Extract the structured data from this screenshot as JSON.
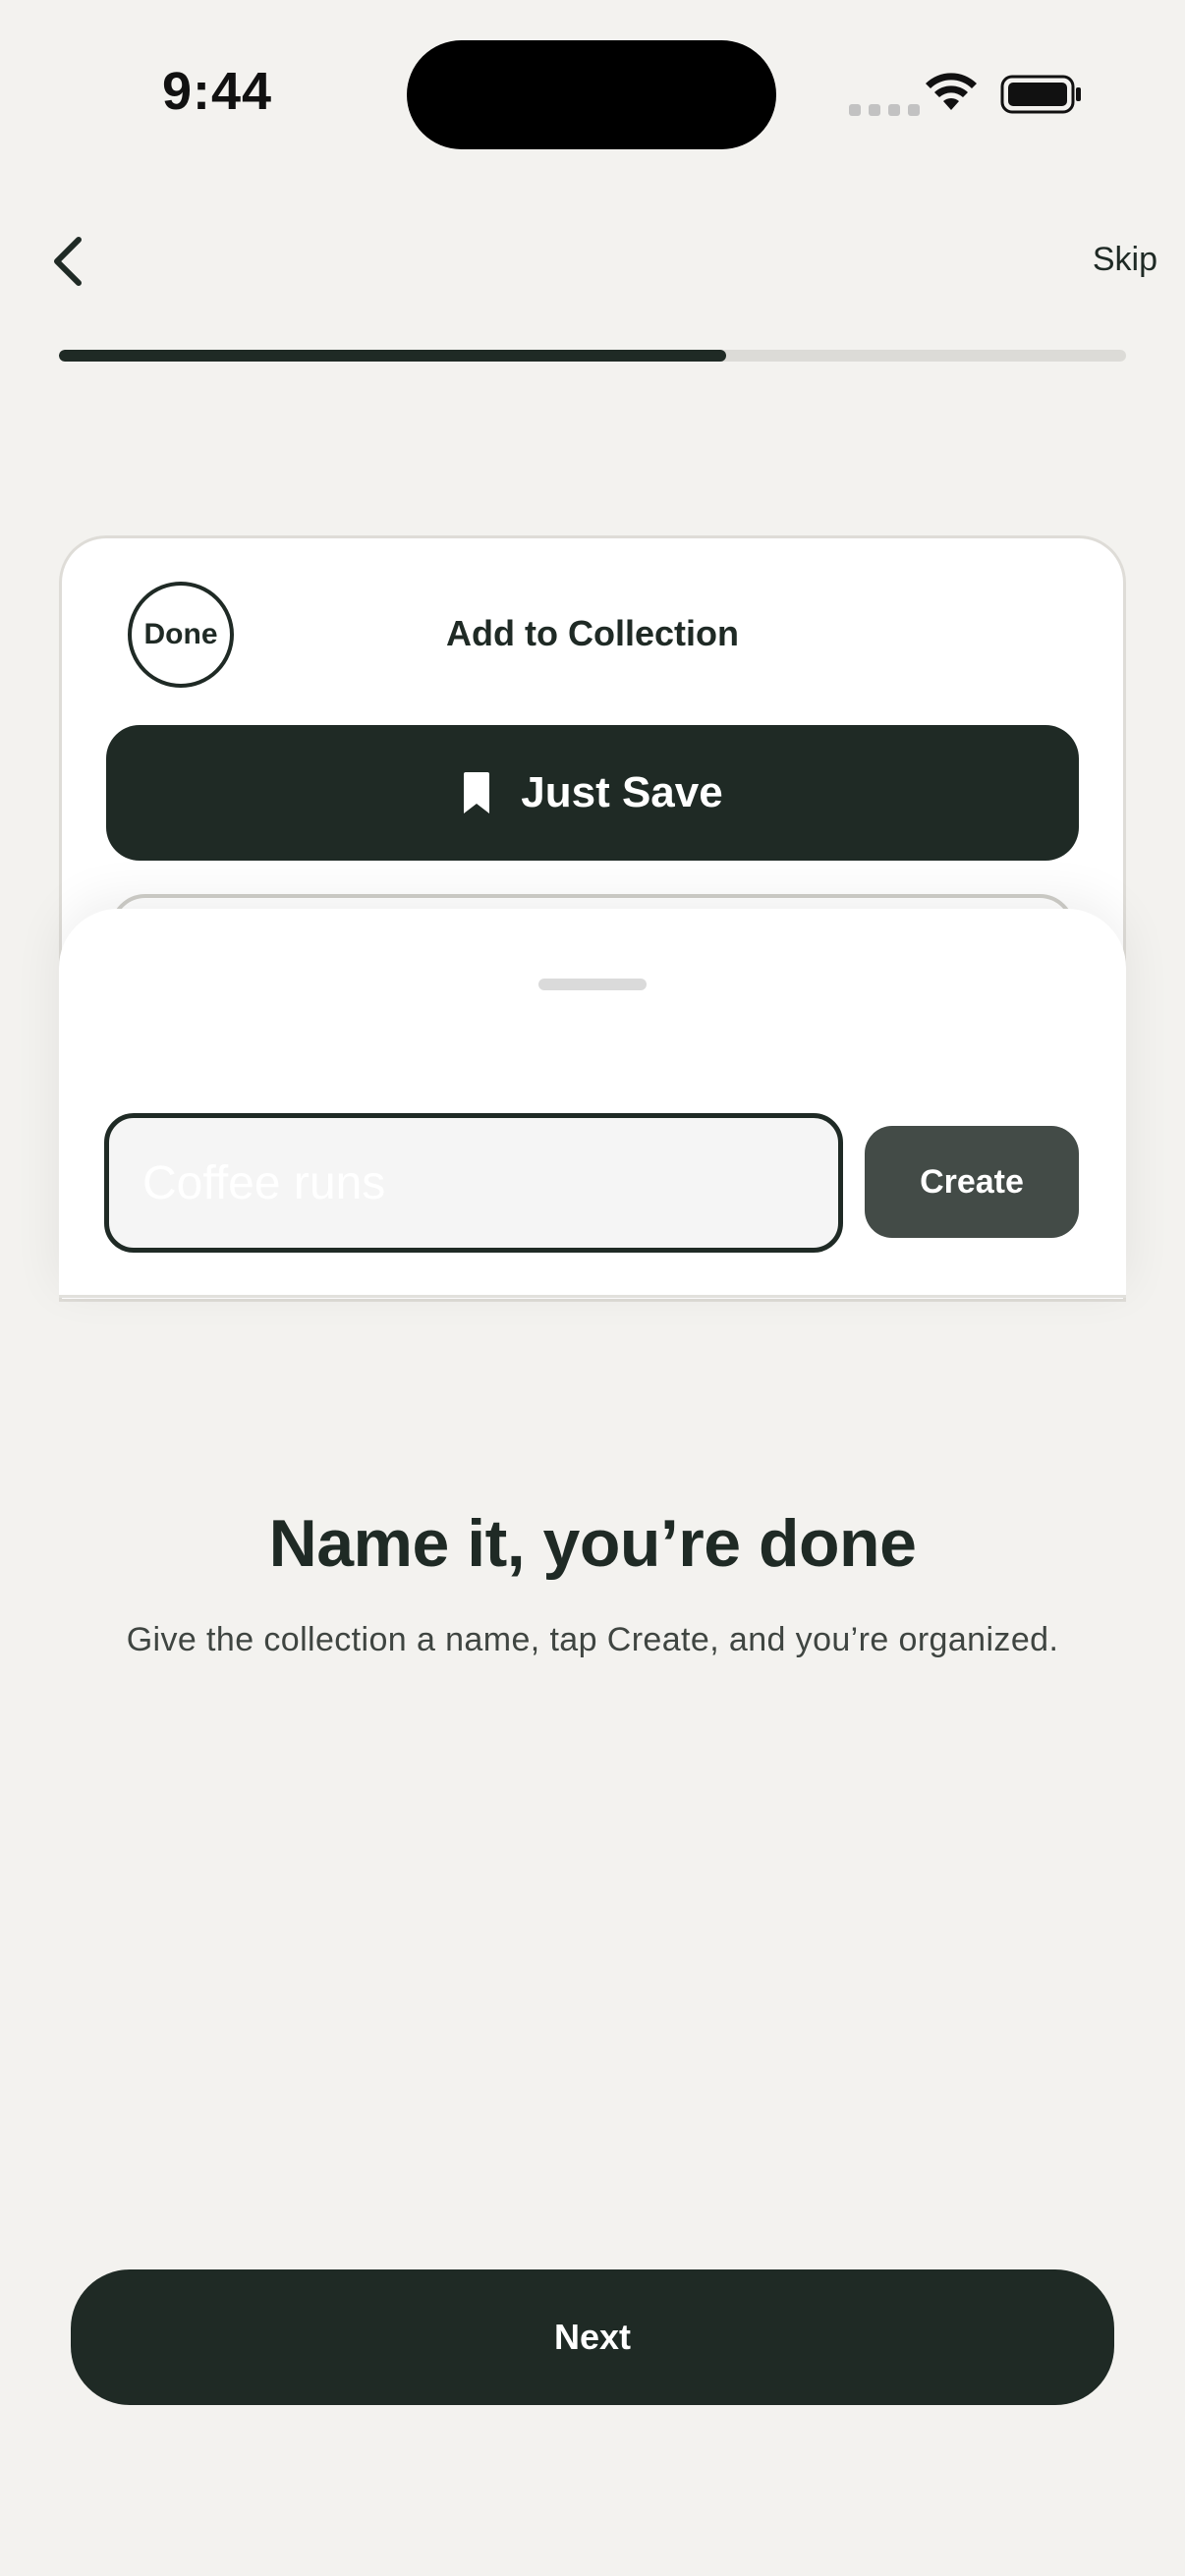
{
  "status_bar": {
    "time": "9:44"
  },
  "nav": {
    "back_icon": "chevron-left-icon",
    "skip_label": "Skip"
  },
  "progress": {
    "fraction": 0.625
  },
  "card": {
    "done_label": "Done",
    "title": "Add to Collection",
    "just_save_label": "Just Save",
    "just_save_icon": "bookmark-icon"
  },
  "sheet": {
    "input_placeholder": "Coffee runs",
    "input_value": "",
    "create_label": "Create"
  },
  "onboarding": {
    "headline": "Name it, you’re done",
    "subtext": "Give the collection a name, tap Create, and you’re organized."
  },
  "footer": {
    "next_label": "Next"
  },
  "colors": {
    "background": "#f3f2ef",
    "primary": "#1f2a25",
    "create_button": "#434b47"
  }
}
